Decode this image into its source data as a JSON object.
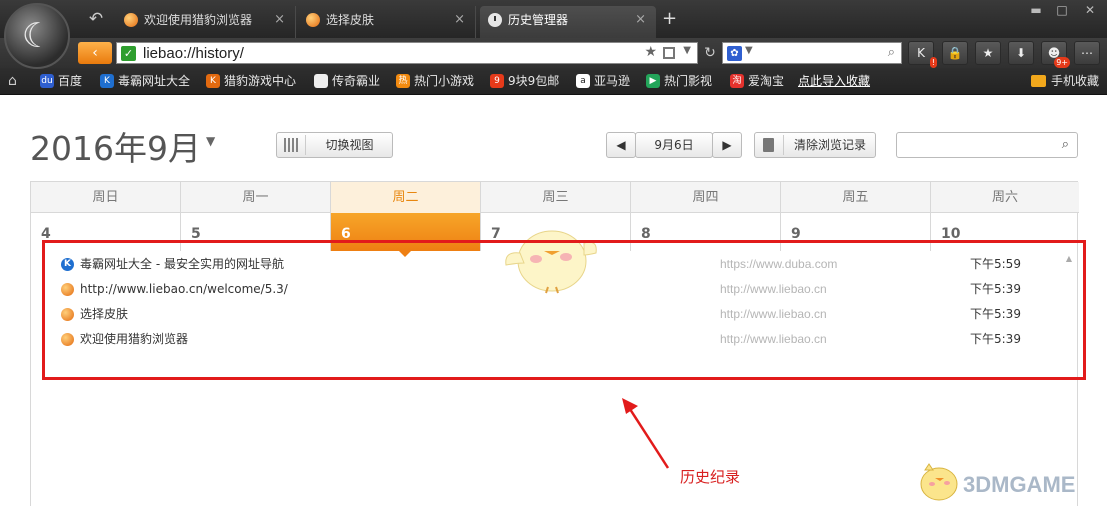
{
  "tabs": [
    {
      "label": "欢迎使用猎豹浏览器",
      "active": false
    },
    {
      "label": "选择皮肤",
      "active": false
    },
    {
      "label": "历史管理器",
      "active": true
    }
  ],
  "tab_close_glyph": "×",
  "new_tab_glyph": "+",
  "address": {
    "url": "liebao://history/"
  },
  "toolbar_badges": {
    "k_badge": "!",
    "game_badge": "9+"
  },
  "bookmarks": [
    {
      "label": "百度",
      "icon": "baidu-icon",
      "color": "#2f5fd0",
      "glyph": "du"
    },
    {
      "label": "毒霸网址大全",
      "icon": "duba-icon",
      "color": "#1f6fd0",
      "glyph": "K"
    },
    {
      "label": "猎豹游戏中心",
      "icon": "liebao-game-icon",
      "color": "#e36a10",
      "glyph": "K"
    },
    {
      "label": "传奇霸业",
      "icon": "page-icon",
      "color": "#eeeeee",
      "glyph": ""
    },
    {
      "label": "热门小游戏",
      "icon": "games-icon",
      "color": "#f28a10",
      "glyph": "热"
    },
    {
      "label": "9块9包邮",
      "icon": "tag-icon",
      "color": "#e53a1a",
      "glyph": "9"
    },
    {
      "label": "亚马逊",
      "icon": "amazon-icon",
      "color": "#ffffff",
      "glyph": "a"
    },
    {
      "label": "热门影视",
      "icon": "play-icon",
      "color": "#23a55a",
      "glyph": "▶"
    },
    {
      "label": "爱淘宝",
      "icon": "taobao-icon",
      "color": "#e5322d",
      "glyph": "淘"
    }
  ],
  "import_link": "点此导入收藏",
  "mobile_fav": "手机收藏",
  "calendar": {
    "month_title": "2016年9月",
    "view_switch": "切换视图",
    "current_day": "9月6日",
    "clear_history": "清除浏览记录",
    "weekdays": [
      "周日",
      "周一",
      "周二",
      "周三",
      "周四",
      "周五",
      "周六"
    ],
    "days": [
      "4",
      "5",
      "6",
      "7",
      "8",
      "9",
      "10"
    ],
    "active_index": 2
  },
  "history": [
    {
      "title": "毒霸网址大全 - 最安全实用的网址导航",
      "host": "https://www.duba.com",
      "time": "下午5:59",
      "icon": "duba-icon"
    },
    {
      "title": "http://www.liebao.cn/welcome/5.3/",
      "host": "http://www.liebao.cn",
      "time": "下午5:39",
      "icon": "liebao-icon"
    },
    {
      "title": "选择皮肤",
      "host": "http://www.liebao.cn",
      "time": "下午5:39",
      "icon": "liebao-icon"
    },
    {
      "title": "欢迎使用猎豹浏览器",
      "host": "http://www.liebao.cn",
      "time": "下午5:39",
      "icon": "liebao-icon"
    }
  ],
  "annotation": {
    "label": "历史纪录",
    "color": "#e21b1b"
  },
  "watermark": "3DMGAME",
  "colors": {
    "accent": "#ee7f12",
    "active_weekday_bg": "#fdf0db"
  }
}
